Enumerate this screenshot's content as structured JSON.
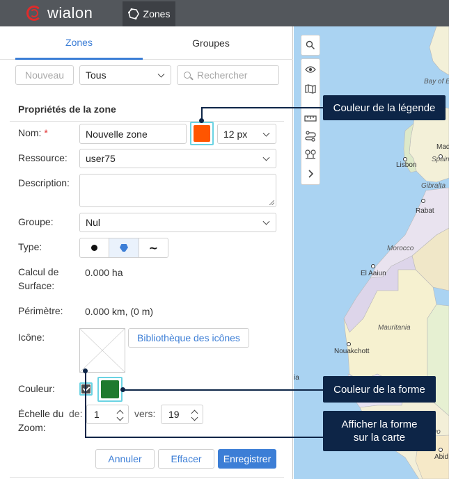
{
  "app": {
    "logo_text": "wialon",
    "nav_item": "Zones"
  },
  "tabs": {
    "zones": "Zones",
    "groups": "Groupes"
  },
  "toolbar": {
    "new_label": "Nouveau",
    "filter_value": "Tous",
    "search_placeholder": "Rechercher"
  },
  "section": {
    "title": "Propriétés de la zone"
  },
  "form": {
    "name_label": "Nom:",
    "name_required_mark": "*",
    "name_value": "Nouvelle zone",
    "legend_color": "#ff5500",
    "line_width": "12 px",
    "resource_label": "Ressource:",
    "resource_value": "user75",
    "description_label": "Description:",
    "group_label": "Groupe:",
    "group_value": "Nul",
    "type_label": "Type:",
    "type_options": [
      "circle",
      "polygon",
      "line"
    ],
    "type_selected": "polygon",
    "area_label_1": "Calcul de",
    "area_label_2": "Surface:",
    "area_value": "0.000 ha",
    "perimeter_label": "Périmètre:",
    "perimeter_value": "0.000 km, (0 m)",
    "icon_label": "Icône:",
    "icon_library_button": "Bibliothèque des icônes",
    "color_label": "Couleur:",
    "show_on_map_checked": true,
    "shape_color": "#1f7a2e",
    "zoom_label_1": "Échelle du",
    "zoom_label_2": "Zoom:",
    "zoom_from_label": "de:",
    "zoom_from": "1",
    "zoom_to_label": "vers:",
    "zoom_to": "19"
  },
  "actions": {
    "cancel": "Annuler",
    "clear": "Effacer",
    "save": "Enregistrer"
  },
  "map": {
    "labels": {
      "bay": "Bay of B",
      "lisbon": "Lisbon",
      "spain": "Spain",
      "mad": "Mad",
      "gibraltar": "Gibralta",
      "rabat": "Rabat",
      "morocco": "Morocco",
      "el_aaiun": "El Aaiun",
      "mauritania": "Mauritania",
      "nouakchott": "Nouakchott",
      "ia": "ia",
      "divo": "e D'Ivo",
      "abid": "Abid"
    }
  },
  "callouts": {
    "legend_color": "Couleur de la légende",
    "shape_color": "Couleur de la forme",
    "show_shape_1": "Afficher la forme",
    "show_shape_2": "sur la carte"
  }
}
